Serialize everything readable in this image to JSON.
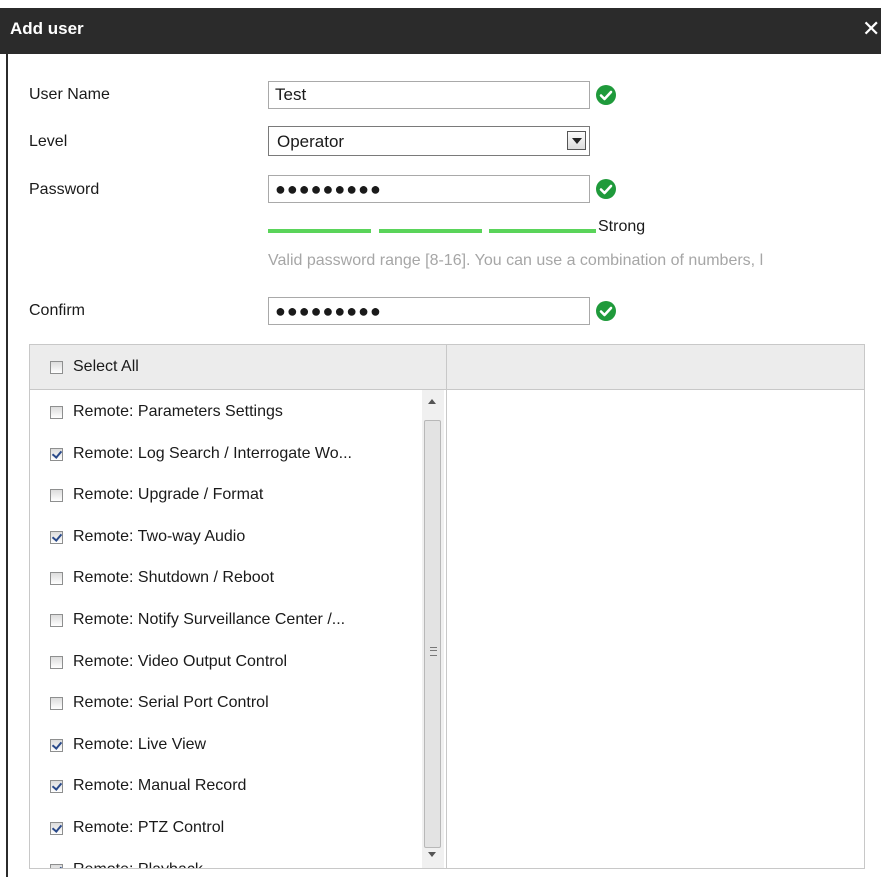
{
  "dialog": {
    "title": "Add user",
    "close_glyph": "✕"
  },
  "form": {
    "username": {
      "label": "User Name",
      "value": "Test",
      "status_icon": "check-circle-icon"
    },
    "level": {
      "label": "Level",
      "selected": "Operator"
    },
    "password": {
      "label": "Password",
      "value": "●●●●●●●●●",
      "status_icon": "check-circle-icon"
    },
    "strength": {
      "label": "Strength",
      "text": "Strong",
      "color": "#5ad45a"
    },
    "hint": "Valid password range [8-16]. You can use a combination of numbers, l",
    "confirm": {
      "label": "Confirm",
      "value": "●●●●●●●●●",
      "status_icon": "check-circle-icon"
    }
  },
  "permissions": {
    "select_all_label": "Select All",
    "select_all_checked": false,
    "items": [
      {
        "label": "Remote: Parameters Settings",
        "checked": false
      },
      {
        "label": "Remote: Log Search / Interrogate Wo...",
        "checked": true
      },
      {
        "label": "Remote: Upgrade / Format",
        "checked": false
      },
      {
        "label": "Remote: Two-way Audio",
        "checked": true
      },
      {
        "label": "Remote: Shutdown / Reboot",
        "checked": false
      },
      {
        "label": "Remote: Notify Surveillance Center /...",
        "checked": false
      },
      {
        "label": "Remote: Video Output Control",
        "checked": false
      },
      {
        "label": "Remote: Serial Port Control",
        "checked": false
      },
      {
        "label": "Remote: Live View",
        "checked": true
      },
      {
        "label": "Remote: Manual Record",
        "checked": true
      },
      {
        "label": "Remote: PTZ Control",
        "checked": true
      },
      {
        "label": "Remote: Playback",
        "checked": true
      }
    ]
  },
  "colors": {
    "titlebar": "#2b2b2b",
    "ok_green": "#1f9a3b",
    "hint": "#a6a6a6"
  }
}
